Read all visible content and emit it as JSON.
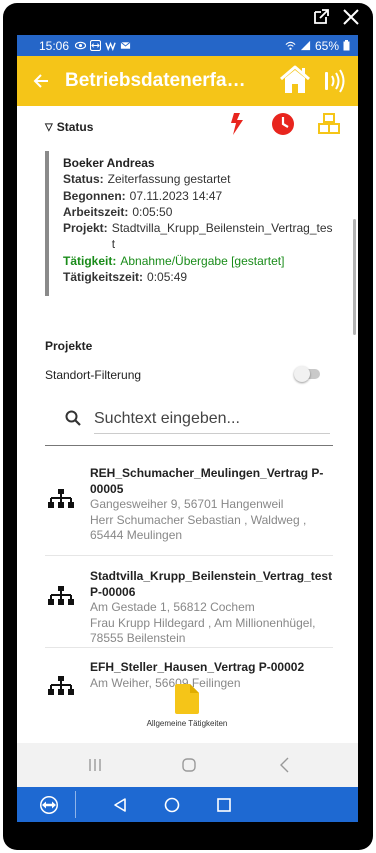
{
  "status_bar": {
    "time": "15:06",
    "left_icons": [
      "eye-icon",
      "teamviewer-icon",
      "w-icon",
      "mail-icon"
    ],
    "right_icons": [
      "wifi-icon",
      "signal-icon"
    ],
    "battery": "65%"
  },
  "app_bar": {
    "title": "Betriebsdatenerfassung",
    "icons": [
      "back-arrow-icon",
      "home-icon",
      "nfc-icon"
    ]
  },
  "status_section": {
    "header": "Status",
    "icons": [
      "lightning-icon",
      "clock-icon",
      "boxes-icon"
    ],
    "colors": {
      "lightning": "#e8251e",
      "clock": "#e8251e",
      "boxes": "#f5c518"
    },
    "name": "Boeker Andreas",
    "rows": [
      {
        "label": "Status:",
        "value": "Zeiterfassung gestartet"
      },
      {
        "label": "Begonnen:",
        "value": "07.11.2023 14:47"
      },
      {
        "label": "Arbeitszeit:",
        "value": "0:05:50"
      },
      {
        "label": "Projekt:",
        "value": "Stadtvilla_Krupp_Beilenstein_Vertrag_test"
      },
      {
        "label": "Tätigkeit:",
        "value": "Abnahme/Übergabe [gestartet]"
      },
      {
        "label": "Tätigkeitszeit:",
        "value": "0:05:49"
      }
    ]
  },
  "projects": {
    "title": "Projekte",
    "filter_label": "Standort-Filterung",
    "filter_on": false,
    "search_placeholder": "Suchtext eingeben...",
    "items": [
      {
        "name": "REH_Schumacher_Meulingen_Vertrag P-00005",
        "address": "Gangesweiher 9, 56701 Hangenweil",
        "client": "Herr Schumacher Sebastian , Waldweg , 65444 Meulingen"
      },
      {
        "name": "Stadtvilla_Krupp_Beilenstein_Vertrag_test P-00006",
        "address": "Am Gestade 1, 56812 Cochem",
        "client": "Frau Krupp Hildegard , Am Millionenhügel, 78555 Beilenstein"
      },
      {
        "name": "EFH_Steller_Hausen_Vertrag P-00002",
        "address": "Am Weiher, 56609 Feilingen",
        "client": ""
      }
    ]
  },
  "bottom_action": {
    "label": "Allgemeine Tätigkeiten",
    "icon": "document-icon",
    "color": "#f5c518"
  },
  "android_nav": [
    "recents-icon",
    "home-circle-icon",
    "back-chevron-icon"
  ],
  "teamviewer_bar": {
    "icons": [
      "teamviewer-logo-icon",
      "back-triangle-icon",
      "home-circle-icon",
      "square-icon"
    ],
    "color": "#1e69d2"
  },
  "window_controls": [
    "popout-icon",
    "close-icon"
  ]
}
